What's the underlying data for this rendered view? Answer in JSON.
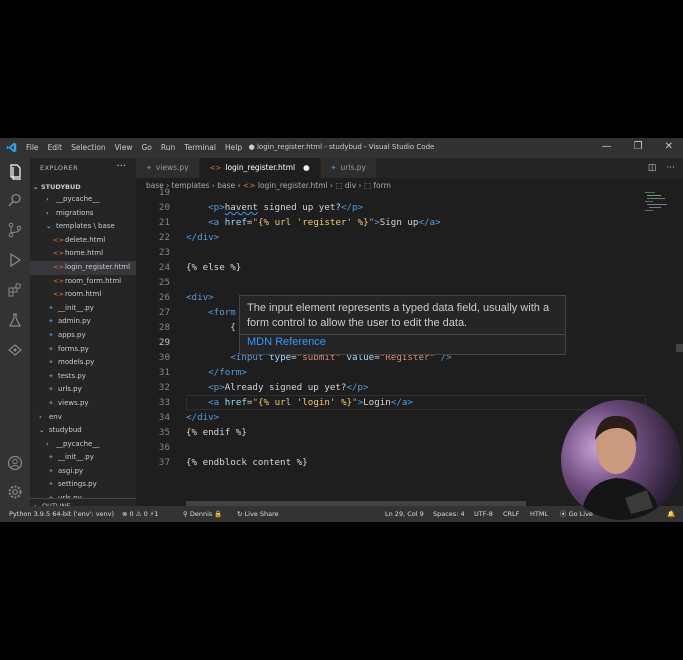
{
  "titlebar": {
    "menu": [
      "File",
      "Edit",
      "Selection",
      "View",
      "Go",
      "Run",
      "Terminal",
      "Help"
    ],
    "title": "● login_register.html - studybud - Visual Studio Code"
  },
  "sidebar": {
    "header": "EXPLORER",
    "root": "STUDYBUD",
    "items": [
      {
        "label": "__pycache__",
        "type": "folder",
        "indent": 2
      },
      {
        "label": "migrations",
        "type": "folder",
        "indent": 2
      },
      {
        "label": "templates \\ base",
        "type": "folder-open",
        "indent": 2
      },
      {
        "label": "delete.html",
        "type": "html",
        "indent": 3
      },
      {
        "label": "home.html",
        "type": "html",
        "indent": 3
      },
      {
        "label": "login_register.html",
        "type": "html",
        "indent": 3,
        "selected": true
      },
      {
        "label": "room_form.html",
        "type": "html",
        "indent": 3
      },
      {
        "label": "room.html",
        "type": "html",
        "indent": 3
      },
      {
        "label": "__init__.py",
        "type": "py",
        "indent": 2
      },
      {
        "label": "admin.py",
        "type": "py",
        "indent": 2
      },
      {
        "label": "apps.py",
        "type": "py",
        "indent": 2
      },
      {
        "label": "forms.py",
        "type": "py",
        "indent": 2
      },
      {
        "label": "models.py",
        "type": "py",
        "indent": 2
      },
      {
        "label": "tests.py",
        "type": "py",
        "indent": 2
      },
      {
        "label": "urls.py",
        "type": "py",
        "indent": 2
      },
      {
        "label": "views.py",
        "type": "py",
        "indent": 2
      },
      {
        "label": "env",
        "type": "folder",
        "indent": 1
      },
      {
        "label": "studybud",
        "type": "folder-open",
        "indent": 1
      },
      {
        "label": "__pycache__",
        "type": "folder",
        "indent": 2
      },
      {
        "label": "__init__.py",
        "type": "py",
        "indent": 2
      },
      {
        "label": "asgi.py",
        "type": "py",
        "indent": 2
      },
      {
        "label": "settings.py",
        "type": "py",
        "indent": 2
      },
      {
        "label": "urls.py",
        "type": "py",
        "indent": 2
      }
    ],
    "outline": "OUTLINE"
  },
  "tabs": [
    {
      "label": "views.py",
      "icon": "py",
      "active": false
    },
    {
      "label": "login_register.html",
      "icon": "html",
      "active": true,
      "dirty": true
    },
    {
      "label": "urls.py",
      "icon": "py",
      "active": false
    }
  ],
  "breadcrumb": [
    "base",
    "templates",
    "base",
    "login_register.html",
    "div",
    "form"
  ],
  "editor": {
    "lines": [
      {
        "n": "19",
        "html": ""
      },
      {
        "n": "20",
        "html": "    <span class='t-tag'>&lt;p&gt;</span><span class='t-txt squig'>havent</span><span class='t-txt'> signed up yet?</span><span class='t-tag'>&lt;/p&gt;</span>"
      },
      {
        "n": "21",
        "html": "    <span class='t-tag'>&lt;a</span> <span class='t-attr'>href</span><span class='t-txt'>=</span><span class='t-str'>\"</span><span class='t-tmpl'>{% url 'register' %}</span><span class='t-str'>\"</span><span class='t-tag'>&gt;</span><span class='t-txt'>Sign up</span><span class='t-tag'>&lt;/a&gt;</span>"
      },
      {
        "n": "22",
        "html": "<span class='t-tag'>&lt;/div&gt;</span>"
      },
      {
        "n": "23",
        "html": ""
      },
      {
        "n": "24",
        "html": "<span class='t-txt'>{% else %}</span>"
      },
      {
        "n": "25",
        "html": ""
      },
      {
        "n": "26",
        "html": "<span class='t-tag'>&lt;div&gt;</span>"
      },
      {
        "n": "27",
        "html": "    <span class='t-tag'>&lt;form</span>"
      },
      {
        "n": "28",
        "html": "        <span class='t-txt'>{</span>"
      },
      {
        "n": "29",
        "html": "",
        "current": true
      },
      {
        "n": "30",
        "html": "        <span class='t-tag'>&lt;input</span> <span class='t-attr'>type</span><span class='t-txt'>=</span><span class='t-str'>\"submit\"</span> <span class='t-attr'>value</span><span class='t-txt'>=</span><span class='t-str'>\"Register\"</span> <span class='t-tag'>/&gt;</span>"
      },
      {
        "n": "31",
        "html": "    <span class='t-tag'>&lt;/form&gt;</span>"
      },
      {
        "n": "32",
        "html": "    <span class='t-tag'>&lt;p&gt;</span><span class='t-txt'>Already signed up yet?</span><span class='t-tag'>&lt;/p&gt;</span>"
      },
      {
        "n": "33",
        "html": "    <span class='t-tag'>&lt;a</span> <span class='t-attr'>href</span><span class='t-txt'>=</span><span class='t-str'>\"</span><span class='t-tmpl'>{% url 'login' %}</span><span class='t-str'>\"</span><span class='t-tag'>&gt;</span><span class='t-txt'>Login</span><span class='t-tag'>&lt;/a&gt;</span>"
      },
      {
        "n": "34",
        "html": "<span class='t-tag'>&lt;/div&gt;</span>"
      },
      {
        "n": "35",
        "html": "<span class='t-txt'>{% endif %}</span>"
      },
      {
        "n": "36",
        "html": ""
      },
      {
        "n": "37",
        "html": "<span class='t-txt'>{% endblock content %}</span>"
      }
    ]
  },
  "hover": {
    "description": "The input element represents a typed data field, usually with a form control to allow the user to edit the data.",
    "link": "MDN Reference"
  },
  "statusbar": {
    "python": "Python 3.9.5 64-bit ('env': venv)",
    "problems": "⊗ 0 ⚠ 0  ⚡1",
    "user": "Dennis",
    "liveshare": "Live Share",
    "position": "Ln 29, Col 9",
    "spaces": "Spaces: 4",
    "encoding": "UTF-8",
    "eol": "CRLF",
    "language": "HTML",
    "golive": "Go Live"
  }
}
